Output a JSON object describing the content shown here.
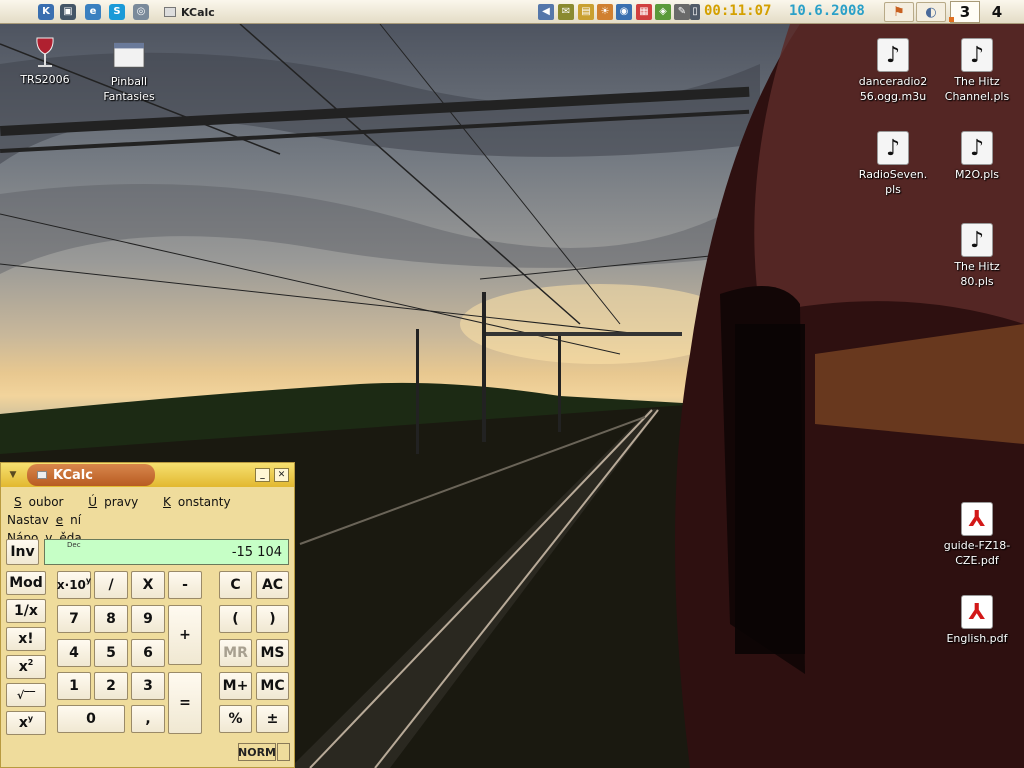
{
  "panel": {
    "launchers": [
      {
        "icon": "kde-menu-icon",
        "glyph": "K",
        "color": "#3a6fb0"
      },
      {
        "icon": "terminal-icon",
        "glyph": "▣",
        "color": "#445566"
      },
      {
        "icon": "konqueror-icon",
        "glyph": "e",
        "color": "#3a80c0"
      },
      {
        "icon": "skype-icon",
        "glyph": "S",
        "color": "#1a9ad8"
      },
      {
        "icon": "system-icon",
        "glyph": "◎",
        "color": "#7a8a9a"
      }
    ],
    "task": {
      "label": "KCalc",
      "icon": "kcalc-icon"
    },
    "tray": [
      {
        "icon": "speaker-icon",
        "glyph": "◀",
        "color": "#5577aa"
      },
      {
        "icon": "klipper-icon",
        "glyph": "✉",
        "color": "#8a8a30"
      },
      {
        "icon": "notes-icon",
        "glyph": "▤",
        "color": "#c9a030"
      },
      {
        "icon": "weather-icon",
        "glyph": "☀",
        "color": "#d08030"
      },
      {
        "icon": "network-icon",
        "glyph": "◉",
        "color": "#3a70b0"
      },
      {
        "icon": "korganizer-icon",
        "glyph": "▦",
        "color": "#d04040"
      },
      {
        "icon": "keyboard-layout-icon",
        "glyph": "◈",
        "color": "#5a9a3a"
      },
      {
        "icon": "updater-icon",
        "glyph": "✎",
        "color": "#6a6a6a"
      },
      {
        "icon": "battery-icon",
        "glyph": "▯",
        "color": "#505a68"
      }
    ],
    "clock_time": "00:11:07",
    "clock_date": "10.6.2008",
    "apps": [
      {
        "icon": "konqueror-app-icon",
        "glyph": "⚑",
        "color": "#c86020"
      },
      {
        "icon": "kcalc-app-icon",
        "glyph": "◐",
        "color": "#4a6a9a"
      }
    ],
    "pager": [
      "3",
      "4"
    ]
  },
  "desktop": {
    "icons": [
      {
        "name": "trs2006",
        "label": "TRS2006",
        "type": "wine"
      },
      {
        "name": "pinball-fantasies",
        "label": "Pinball\nFantasies",
        "type": "window"
      },
      {
        "name": "danceradio",
        "label": "danceradio2\n56.ogg.m3u",
        "type": "music"
      },
      {
        "name": "the-hitz-channel",
        "label": "The Hitz\nChannel.pls",
        "type": "music"
      },
      {
        "name": "radioseven",
        "label": "RadioSeven.\npls",
        "type": "music"
      },
      {
        "name": "m2o",
        "label": "M2O.pls",
        "type": "music"
      },
      {
        "name": "the-hitz-80",
        "label": "The Hitz\n80.pls",
        "type": "music"
      },
      {
        "name": "guide-fz18",
        "label": "guide-FZ18-\nCZE.pdf",
        "type": "pdf"
      },
      {
        "name": "english-pdf",
        "label": "English.pdf",
        "type": "pdf"
      }
    ]
  },
  "kcalc": {
    "title": "KCalc",
    "minimize": "_",
    "close": "✕",
    "menu": [
      {
        "pre": "",
        "u": "S",
        "post": "oubor"
      },
      {
        "pre": "",
        "u": "Ú",
        "post": "pravy"
      },
      {
        "pre": "",
        "u": "K",
        "post": "onstanty"
      },
      {
        "pre": "Nastav",
        "u": "e",
        "post": "ní"
      },
      {
        "pre": "Nápo",
        "u": "v",
        "post": "ěda"
      }
    ],
    "display": {
      "mode": "Dec",
      "value": "-15 104"
    },
    "status": "NORM",
    "buttons": {
      "inv": "Inv",
      "mod": "Mod",
      "recip": "1/x",
      "fact": "x!",
      "square_base": "x",
      "square_exp": "2",
      "sqrt": "√‾‾",
      "power_base": "x",
      "power_exp": "y",
      "exp_base": "x·10",
      "exp_exp": "y",
      "divide": "/",
      "multiply": "X",
      "minus": "-",
      "seven": "7",
      "eight": "8",
      "nine": "9",
      "plus": "+",
      "four": "4",
      "five": "5",
      "six": "6",
      "one": "1",
      "two": "2",
      "three": "3",
      "equals": "=",
      "zero": "0",
      "comma": ",",
      "clear": "C",
      "allclear": "AC",
      "paren_open": "(",
      "paren_close": ")",
      "mr": "MR",
      "ms": "MS",
      "mplus": "M+",
      "mc": "MC",
      "percent": "%",
      "plusminus": "±"
    }
  }
}
